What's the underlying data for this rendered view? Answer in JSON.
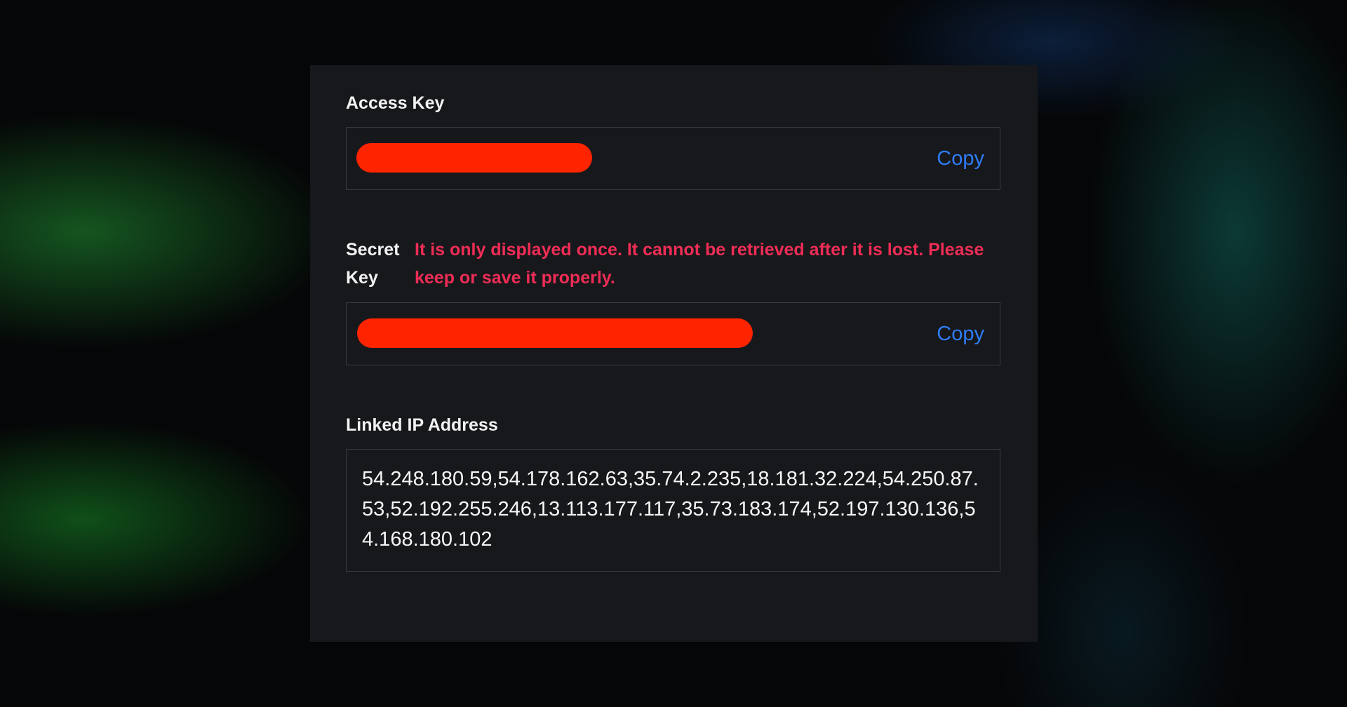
{
  "access_key": {
    "label": "Access Key",
    "copy_label": "Copy"
  },
  "secret_key": {
    "label": "Secret Key",
    "warning": "It is only displayed once. It cannot be retrieved after it is lost. Please keep or save it properly.",
    "copy_label": "Copy"
  },
  "linked_ip": {
    "label": "Linked IP Address",
    "value": "54.248.180.59,54.178.162.63,35.74.2.235,18.181.32.224,54.250.87.53,52.192.255.246,13.113.177.117,35.73.183.174,52.197.130.136,54.168.180.102"
  },
  "colors": {
    "card_background": "#17181b",
    "copy_link": "#2e7cf6",
    "warning_text": "#ef2d56",
    "redaction": "#ff2400"
  }
}
